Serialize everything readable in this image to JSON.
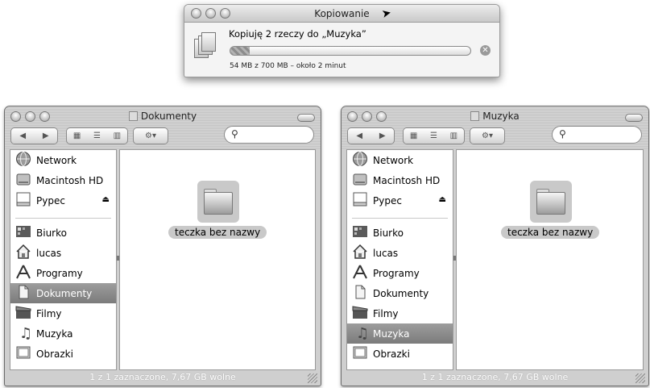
{
  "copy_dialog": {
    "title": "Kopiowanie",
    "message": "Kopiuję 2 rzeczy do „Muzyka”",
    "status": "54 MB z 700 MB – około 2 minut",
    "progress_percent": 8
  },
  "windows": [
    {
      "title": "Dokumenty",
      "search_value": "",
      "sidebar_devices": [
        {
          "label": "Network",
          "icon": "network-globe-icon"
        },
        {
          "label": "Macintosh HD",
          "icon": "hard-drive-icon"
        },
        {
          "label": "Pypec",
          "icon": "disk-icon",
          "eject": true
        }
      ],
      "sidebar_places": [
        {
          "label": "Biurko",
          "icon": "desktop-icon"
        },
        {
          "label": "lucas",
          "icon": "home-icon"
        },
        {
          "label": "Programy",
          "icon": "applications-icon"
        },
        {
          "label": "Dokumenty",
          "icon": "documents-icon",
          "selected": true
        },
        {
          "label": "Filmy",
          "icon": "movies-icon"
        },
        {
          "label": "Muzyka",
          "icon": "music-icon"
        },
        {
          "label": "Obrazki",
          "icon": "pictures-icon"
        }
      ],
      "folder_label": "teczka bez nazwy",
      "status": "1 z 1 zaznaczone, 7,67 GB wolne"
    },
    {
      "title": "Muzyka",
      "search_value": "",
      "sidebar_devices": [
        {
          "label": "Network",
          "icon": "network-globe-icon"
        },
        {
          "label": "Macintosh HD",
          "icon": "hard-drive-icon"
        },
        {
          "label": "Pypec",
          "icon": "disk-icon",
          "eject": true
        }
      ],
      "sidebar_places": [
        {
          "label": "Biurko",
          "icon": "desktop-icon"
        },
        {
          "label": "lucas",
          "icon": "home-icon"
        },
        {
          "label": "Programy",
          "icon": "applications-icon"
        },
        {
          "label": "Dokumenty",
          "icon": "documents-icon"
        },
        {
          "label": "Filmy",
          "icon": "movies-icon"
        },
        {
          "label": "Muzyka",
          "icon": "music-icon",
          "selected": true
        },
        {
          "label": "Obrazki",
          "icon": "pictures-icon"
        }
      ],
      "folder_label": "teczka bez nazwy",
      "status": "1 z 1 zaznaczone, 7,67 GB wolne"
    }
  ]
}
